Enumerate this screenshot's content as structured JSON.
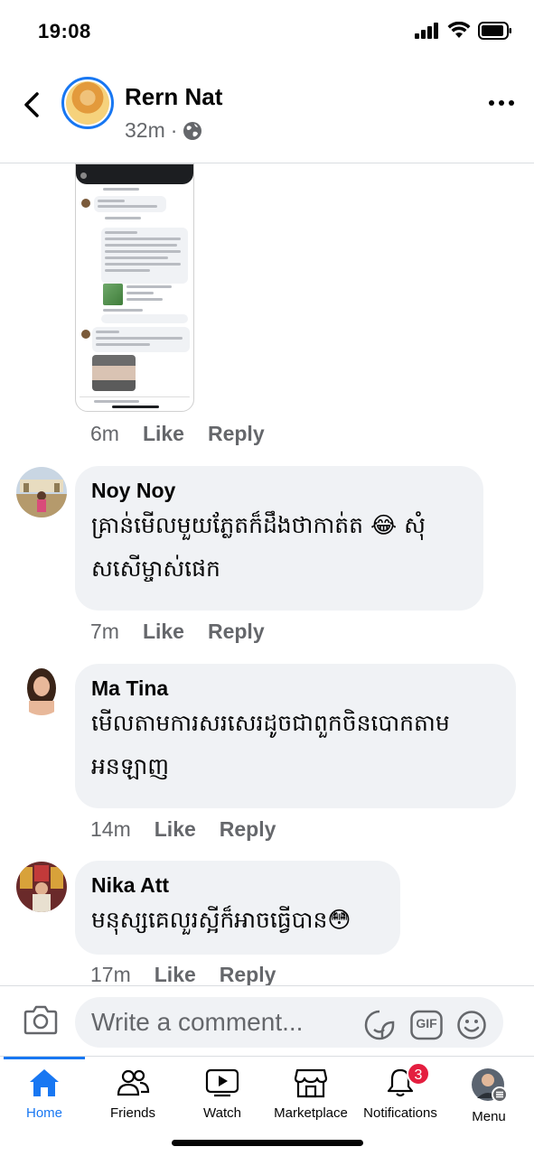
{
  "status_bar": {
    "time": "19:08"
  },
  "header": {
    "author_name": "Rern Nat",
    "post_age": "32m",
    "separator": "·"
  },
  "attached_comment": {
    "time": "6m",
    "like_label": "Like",
    "reply_label": "Reply"
  },
  "comments": [
    {
      "name": "Noy Noy",
      "text_line1": "គ្រាន់មើលមួយភ្លែតក៏ដឹងថាកាត់ត 😂 សុំ",
      "text_line2": "សសើម្ចាស់ផេក",
      "time": "7m",
      "like_label": "Like",
      "reply_label": "Reply"
    },
    {
      "name": "Ma Tina",
      "text_line1": "មើលតាមការសរសេរដូចជាពួកចិនបោកតាម",
      "text_line2": "អនឡាញ",
      "time": "14m",
      "like_label": "Like",
      "reply_label": "Reply"
    },
    {
      "name": "Nika Att",
      "text_line1": "មនុស្សគេលួរស្អីក៏អាចធ្វើបាន😳",
      "time": "17m",
      "like_label": "Like",
      "reply_label": "Reply"
    }
  ],
  "composer": {
    "placeholder": "Write a comment...",
    "gif_label": "GIF"
  },
  "tabs": [
    {
      "label": "Home",
      "icon": "home-icon",
      "active": true
    },
    {
      "label": "Friends",
      "icon": "friends-icon"
    },
    {
      "label": "Watch",
      "icon": "watch-icon"
    },
    {
      "label": "Marketplace",
      "icon": "marketplace-icon"
    },
    {
      "label": "Notifications",
      "icon": "bell-icon",
      "badge": "3"
    },
    {
      "label": "Menu",
      "icon": "menu-avatar-icon"
    }
  ],
  "colors": {
    "accent": "#1877f2",
    "bubble": "#f0f2f5",
    "secondary_text": "#65676b",
    "badge": "#e41e3f"
  }
}
